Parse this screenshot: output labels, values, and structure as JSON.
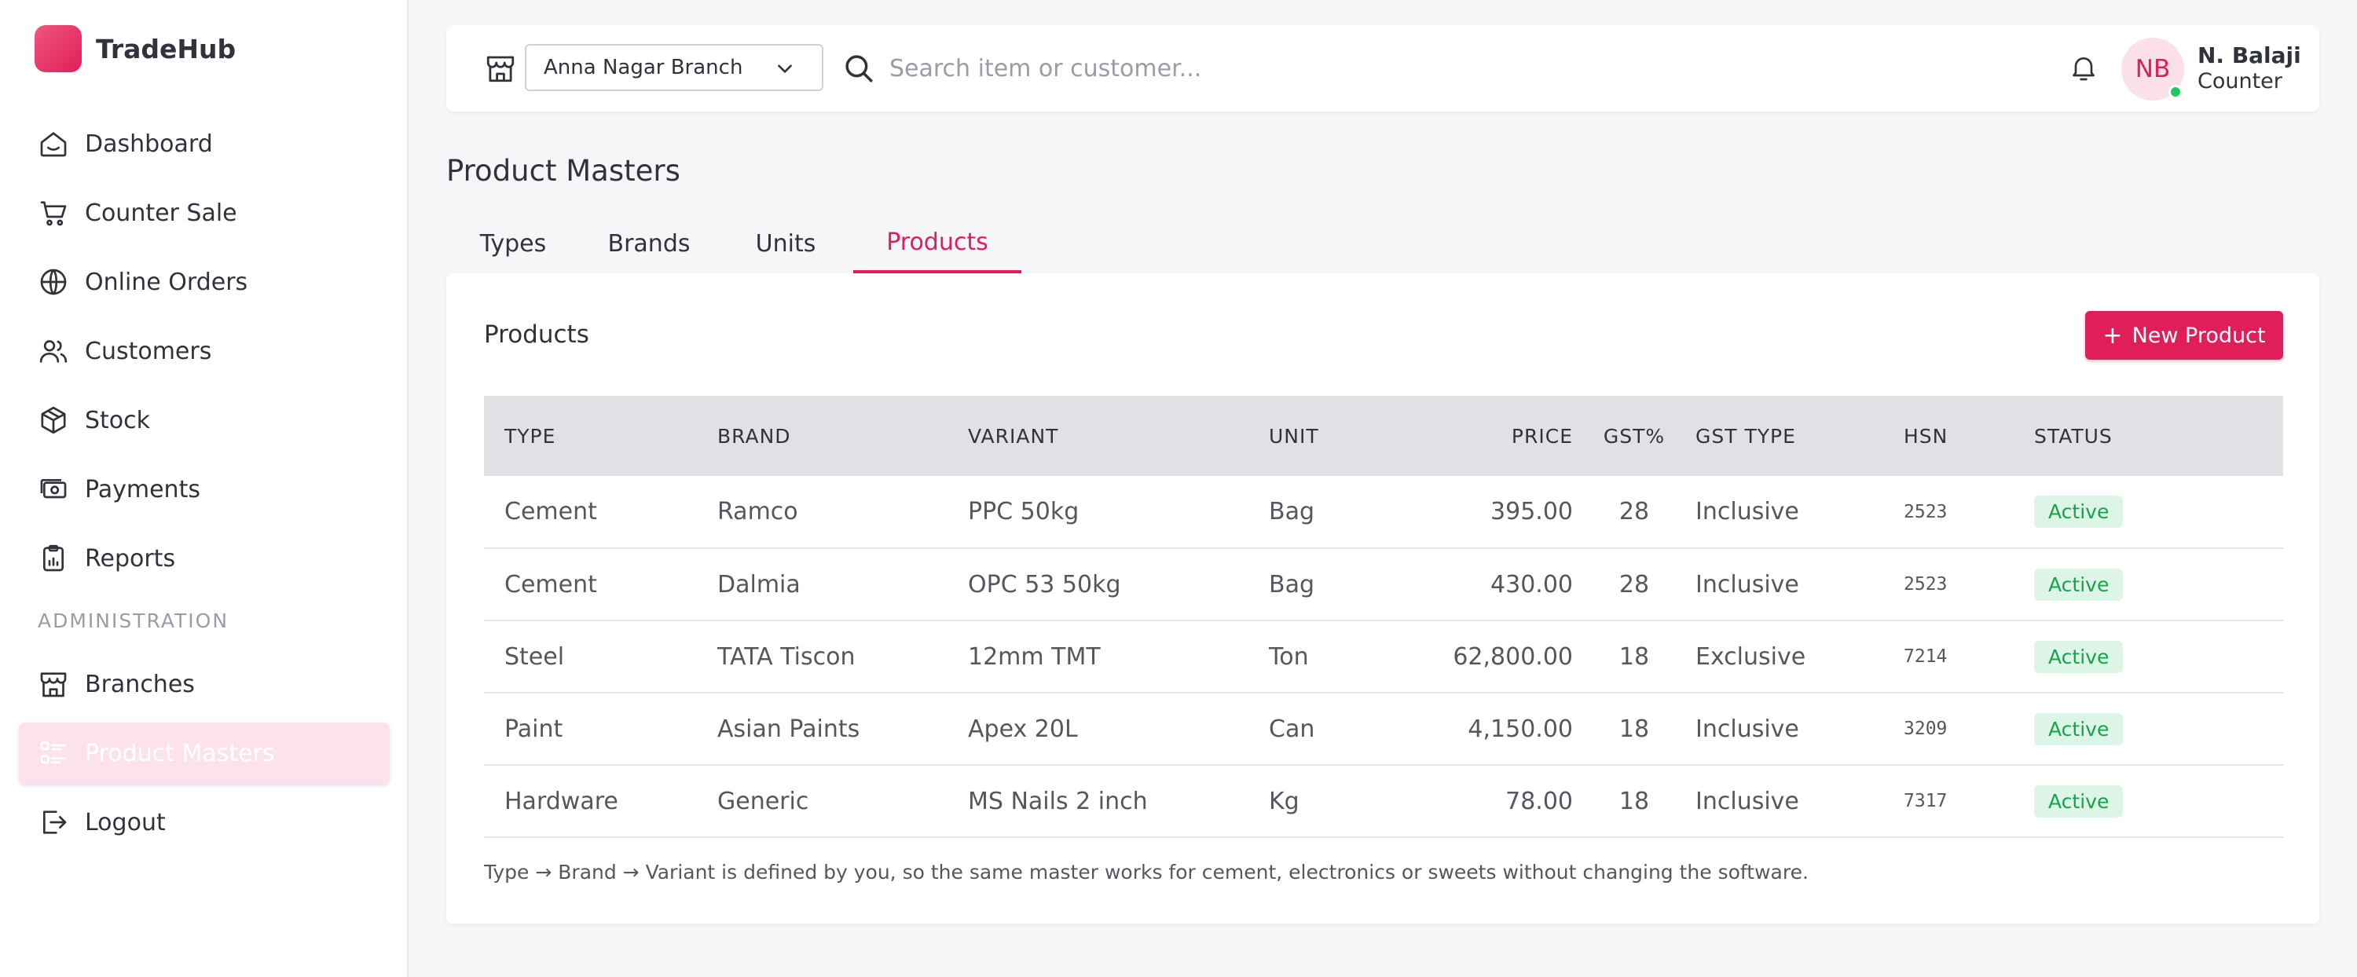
{
  "app": {
    "name": "TradeHub",
    "brand_color": "#e01e5a"
  },
  "sidebar": {
    "items": [
      {
        "label": "Dashboard",
        "icon": "home-icon"
      },
      {
        "label": "Counter Sale",
        "icon": "cart-icon"
      },
      {
        "label": "Online Orders",
        "icon": "globe-icon"
      },
      {
        "label": "Customers",
        "icon": "users-icon"
      },
      {
        "label": "Stock",
        "icon": "box-icon"
      },
      {
        "label": "Payments",
        "icon": "cash-icon"
      },
      {
        "label": "Reports",
        "icon": "clipboard-icon"
      }
    ],
    "section_label": "ADMINISTRATION",
    "admin_items": [
      {
        "label": "Branches",
        "icon": "store-icon"
      },
      {
        "label": "Product Masters",
        "icon": "list-icon",
        "active": true
      },
      {
        "label": "Logout",
        "icon": "logout-icon"
      }
    ]
  },
  "topbar": {
    "branch": "Anna Nagar Branch",
    "search_placeholder": "Search item or customer...",
    "user": {
      "initials": "NB",
      "name": "N. Balaji",
      "role": "Counter",
      "status_color": "#22c55e"
    }
  },
  "page": {
    "title": "Product Masters",
    "tabs": [
      "Types",
      "Brands",
      "Units",
      "Products"
    ],
    "active_tab": "Products"
  },
  "card": {
    "title": "Products",
    "new_button": "New Product",
    "columns": [
      "TYPE",
      "BRAND",
      "VARIANT",
      "UNIT",
      "PRICE",
      "GST%",
      "GST TYPE",
      "HSN",
      "STATUS"
    ],
    "rows": [
      [
        "Cement",
        "Ramco",
        "PPC 50kg",
        "Bag",
        "395.00",
        "28",
        "Inclusive",
        "2523",
        "Active"
      ],
      [
        "Cement",
        "Dalmia",
        "OPC 53 50kg",
        "Bag",
        "430.00",
        "28",
        "Inclusive",
        "2523",
        "Active"
      ],
      [
        "Steel",
        "TATA Tiscon",
        "12mm TMT",
        "Ton",
        "62,800.00",
        "18",
        "Exclusive",
        "7214",
        "Active"
      ],
      [
        "Paint",
        "Asian Paints",
        "Apex 20L",
        "Can",
        "4,150.00",
        "18",
        "Inclusive",
        "3209",
        "Active"
      ],
      [
        "Hardware",
        "Generic",
        "MS Nails 2 inch",
        "Kg",
        "78.00",
        "18",
        "Inclusive",
        "7317",
        "Active"
      ]
    ],
    "footnote": "Type → Brand → Variant is defined by you, so the same master works for cement, electronics or sweets without changing the software."
  }
}
